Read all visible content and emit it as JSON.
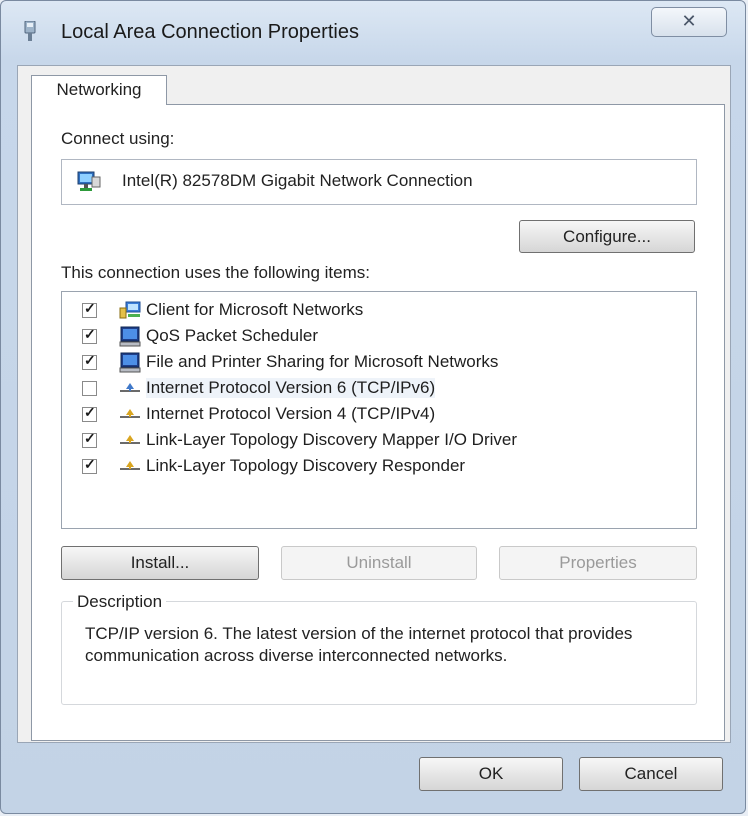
{
  "window": {
    "title": "Local Area Connection Properties",
    "close_glyph": "✕"
  },
  "tabs": [
    {
      "label": "Networking",
      "active": true
    }
  ],
  "connect_using": {
    "label": "Connect using:",
    "adapter_name": "Intel(R) 82578DM Gigabit Network Connection",
    "adapter_icon": "network-adapter-icon"
  },
  "buttons": {
    "configure": "Configure...",
    "install": "Install...",
    "uninstall": "Uninstall",
    "properties": "Properties",
    "ok": "OK",
    "cancel": "Cancel"
  },
  "items_label": "This connection uses the following items:",
  "items": [
    {
      "label": "Client for Microsoft Networks",
      "checked": true,
      "icon": "network-client-icon"
    },
    {
      "label": "QoS Packet Scheduler",
      "checked": true,
      "icon": "network-service-icon"
    },
    {
      "label": "File and Printer Sharing for Microsoft Networks",
      "checked": true,
      "icon": "network-service-icon"
    },
    {
      "label": "Internet Protocol Version 6 (TCP/IPv6)",
      "checked": false,
      "selected": true,
      "icon": "protocol-icon"
    },
    {
      "label": "Internet Protocol Version 4 (TCP/IPv4)",
      "checked": true,
      "icon": "protocol-icon"
    },
    {
      "label": "Link-Layer Topology Discovery Mapper I/O Driver",
      "checked": true,
      "icon": "protocol-icon"
    },
    {
      "label": "Link-Layer Topology Discovery Responder",
      "checked": true,
      "icon": "protocol-icon"
    }
  ],
  "description": {
    "title": "Description",
    "text": "TCP/IP version 6. The latest version of the internet protocol that provides communication across diverse interconnected networks."
  },
  "colors": {
    "accent": "#1a5fb4",
    "disabled_text": "#9a9a9a"
  }
}
